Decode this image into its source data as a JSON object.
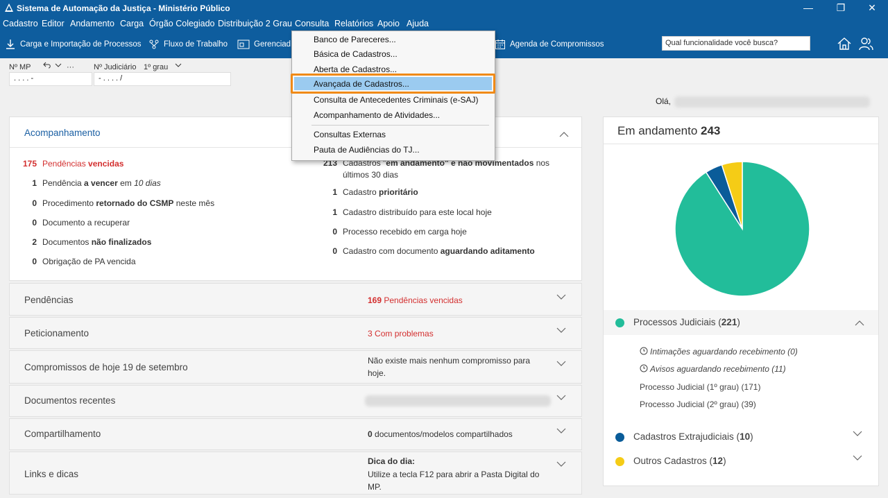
{
  "window": {
    "title": "Sistema de Automação da Justiça - Ministério Público",
    "minimize": "—",
    "restore": "❐",
    "close": "✕"
  },
  "menu": {
    "cadastro": "Cadastro",
    "editor": "Editor",
    "andamento": "Andamento",
    "carga": "Carga",
    "orgao": "Órgão Colegiado",
    "distribuicao": "Distribuição 2 Grau",
    "consulta": "Consulta",
    "relatorios": "Relatórios",
    "apoio": "Apoio",
    "ajuda": "Ajuda"
  },
  "toolbar": {
    "carga": "Carga e Importação de Processos",
    "fluxo": "Fluxo de Trabalho",
    "gerenciador": "Gerenciad",
    "agenda": "Agenda de Compromissos",
    "search_placeholder": "Qual funcionalidade você busca?"
  },
  "fields": {
    "mp_label": "Nº MP",
    "mp_value": ". . . . -",
    "more": "···",
    "judiciario_label": "Nº Judiciário",
    "grau": "1º grau",
    "judiciario_value": "- . . . . /"
  },
  "greeting": "Olá,",
  "acompanhamento": {
    "title": "Acompanhamento",
    "left": [
      {
        "n": "175",
        "pre": "Pendências ",
        "bold": "vencidas",
        "post": "",
        "red": true
      },
      {
        "n": "1",
        "pre": "Pendência ",
        "bold": "a vencer",
        "post": " em ",
        "ital": "10 dias"
      },
      {
        "n": "0",
        "pre": "Procedimento ",
        "bold": "retornado do CSMP",
        "post": " neste mês"
      },
      {
        "n": "0",
        "pre": "Documento a recuperar",
        "bold": "",
        "post": ""
      },
      {
        "n": "2",
        "pre": "Documentos ",
        "bold": "não finalizados",
        "post": ""
      },
      {
        "n": "0",
        "pre": "Obrigação de PA vencida",
        "bold": "",
        "post": ""
      }
    ],
    "right": [
      {
        "n": "213",
        "pre": "Cadastros \"",
        "bold": "em andamento\" e não movimentados",
        "post": " nos",
        "line2": "últimos 30 dias"
      },
      {
        "n": "1",
        "pre": "Cadastro ",
        "bold": "prioritário",
        "post": ""
      },
      {
        "n": "1",
        "pre": "Cadastro distribuído para este local hoje",
        "bold": "",
        "post": ""
      },
      {
        "n": "0",
        "pre": "Processo recebido em carga hoje",
        "bold": "",
        "post": ""
      },
      {
        "n": "0",
        "pre": "Cadastro com documento ",
        "bold": "aguardando aditamento",
        "post": ""
      }
    ]
  },
  "cards": {
    "pendencias": {
      "title": "Pendências",
      "count": "169",
      "info": " Pendências vencidas"
    },
    "peticionamento": {
      "title": "Peticionamento",
      "count": "3",
      "info": " Com problemas"
    },
    "compromissos": {
      "title": "Compromissos de hoje 19 de setembro",
      "info1": "Não existe mais nenhum compromisso para",
      "info2": "hoje."
    },
    "documentos": {
      "title": "Documentos recentes"
    },
    "compartilhamento": {
      "title": "Compartilhamento",
      "count": "0",
      "info": " documentos/modelos compartilhados"
    },
    "links": {
      "title": "Links e dicas",
      "dica_title": "Dica do dia:",
      "dica1": "Utilize a tecla F12 para abrir a Pasta Digital do",
      "dica2": "MP."
    }
  },
  "right_panel": {
    "title": "Em andamento ",
    "total": "243",
    "legend": [
      {
        "label": "Processos Judiciais (",
        "count": "221",
        "close": ")",
        "color": "#22bd9a"
      },
      {
        "label": "Cadastros Extrajudiciais (",
        "count": "10",
        "close": ")",
        "color": "#0a5c99"
      },
      {
        "label": "Outros Cadastros (",
        "count": "12",
        "close": ")",
        "color": "#f5cc16"
      }
    ],
    "sub": {
      "intimacoes": "Intimações aguardando recebimento (0)",
      "avisos": "Avisos aguardando recebimento (11)",
      "grau1": "Processo Judicial (1º grau) (171)",
      "grau2": "Processo Judicial (2º grau) (39)"
    }
  },
  "chart_data": {
    "type": "pie",
    "categories": [
      "Processos Judiciais",
      "Cadastros Extrajudiciais",
      "Outros Cadastros"
    ],
    "values": [
      221,
      10,
      12
    ],
    "colors": [
      "#22bd9a",
      "#0a5c99",
      "#f5cc16"
    ],
    "title": "Em andamento 243"
  },
  "dropdown": {
    "items": [
      "Banco de Pareceres...",
      "Básica de Cadastros...",
      "Aberta de Cadastros...",
      "Avançada de Cadastros...",
      "Consulta de Antecedentes Criminais (e-SAJ)",
      "Acompanhamento de Atividades...",
      "Consultas Externas",
      "Pauta de Audiências do TJ..."
    ]
  }
}
